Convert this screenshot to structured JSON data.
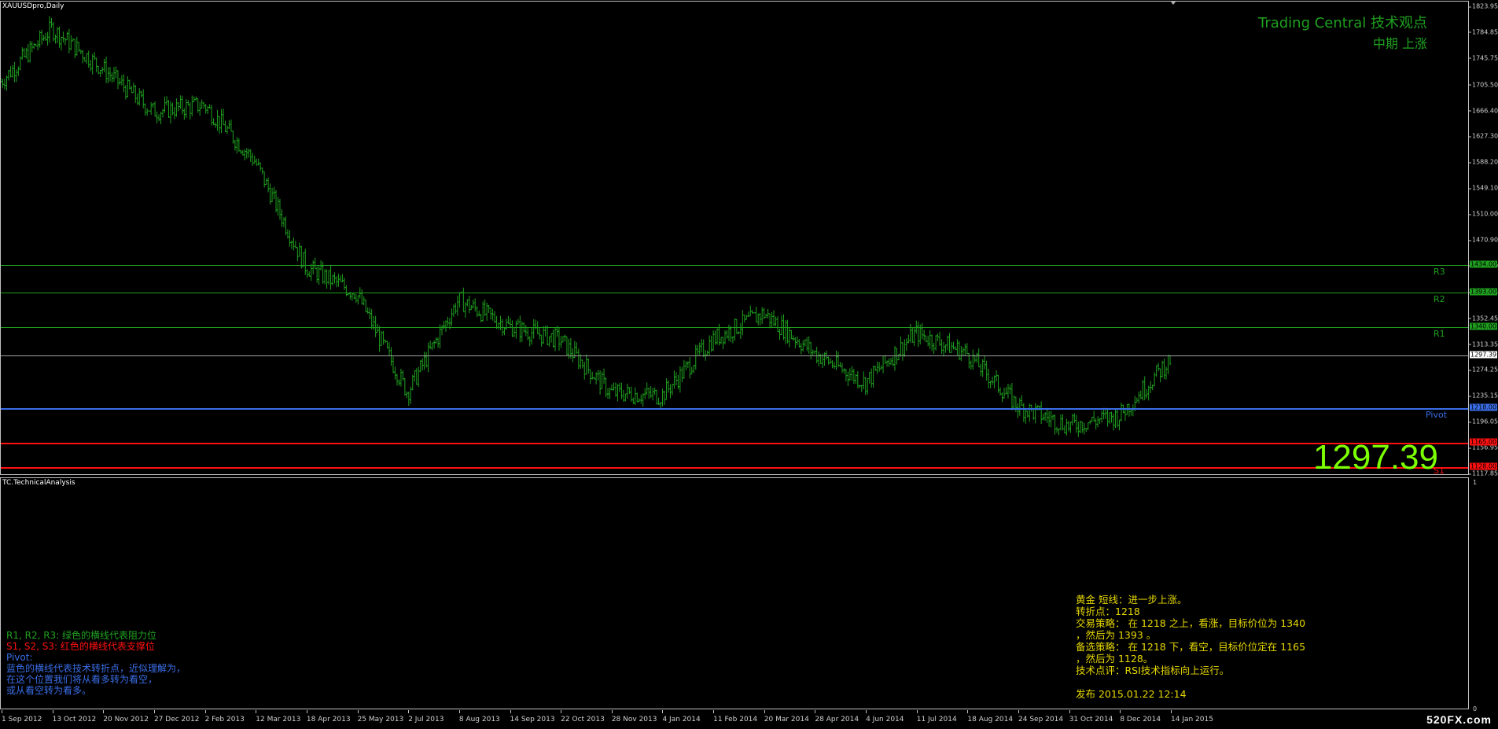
{
  "window": {
    "chart_title": "XAUUSDpro,Daily",
    "indicator_title": "TC.TechnicalAnalysis"
  },
  "header": {
    "title": "Trading Central 技术观点",
    "subtitle": "中期 上涨"
  },
  "current_price": "1297.39",
  "price_axis": [
    "1823.95",
    "1784.85",
    "1745.75",
    "1705.50",
    "1666.40",
    "1627.30",
    "1588.20",
    "1549.10",
    "1510.00",
    "1470.90",
    "1431.80",
    "1391.55",
    "1352.45",
    "1313.35",
    "1274.25",
    "1235.15",
    "1196.05",
    "1156.95",
    "1117.85"
  ],
  "levels": [
    {
      "name": "R3",
      "value": "1434.00",
      "price": 1434,
      "color": "#1fa01f",
      "tag_bg": "#1fa01f",
      "tag_fg": "#000"
    },
    {
      "name": "R2",
      "value": "1393.00",
      "price": 1393,
      "color": "#1fa01f",
      "tag_bg": "#1fa01f",
      "tag_fg": "#000"
    },
    {
      "name": "R1",
      "value": "1340.00",
      "price": 1340,
      "color": "#1fa01f",
      "tag_bg": "#1fa01f",
      "tag_fg": "#000"
    },
    {
      "name": "",
      "value": "1297.39",
      "price": 1297.39,
      "color": "#a0a0a0",
      "tag_bg": "#ffffff",
      "tag_fg": "#000"
    },
    {
      "name": "Pivot",
      "value": "1218.00",
      "price": 1218,
      "color": "#3a6ee8",
      "tag_bg": "#3a6ee8",
      "tag_fg": "#000"
    },
    {
      "name": "",
      "value": "1165.00",
      "price": 1165,
      "color": "#ff1010",
      "tag_bg": "#ff1010",
      "tag_fg": "#000"
    },
    {
      "name": "S1",
      "value": "1128.00",
      "price": 1128,
      "color": "#ff1010",
      "tag_bg": "#ff1010",
      "tag_fg": "#000"
    }
  ],
  "date_axis": [
    "1 Sep 2012",
    "13 Oct 2012",
    "20 Nov 2012",
    "27 Dec 2012",
    "2 Feb 2013",
    "12 Mar 2013",
    "18 Apr 2013",
    "25 May 2013",
    "2 Jul 2013",
    "8 Aug 2013",
    "14 Sep 2013",
    "22 Oct 2013",
    "28 Nov 2013",
    "4 Jan 2014",
    "11 Feb 2014",
    "20 Mar 2014",
    "28 Apr 2014",
    "4 Jun 2014",
    "11 Jul 2014",
    "18 Aug 2014",
    "24 Sep 2014",
    "31 Oct 2014",
    "8 Dec 2014",
    "14 Jan 2015"
  ],
  "indicator_scale": {
    "top": "1",
    "bottom": "0"
  },
  "legend": {
    "resistance": "R1, R2, R3: 绿色的横线代表阻力位",
    "support": "S1, S2, S3: 红色的横线代表支撑位",
    "pivot_title": "Pivot:",
    "pivot_lines": [
      "蓝色的横线代表技术转折点，近似理解为，",
      "在这个位置我们将从看多转为看空，",
      "或从看空转为看多。"
    ]
  },
  "analysis": {
    "lines": [
      "黄金 短线：进一步上涨。",
      "转折点：1218",
      "交易策略： 在 1218 之上，看涨，目标价位为 1340",
      "，然后为 1393 。",
      "备选策略： 在 1218 下，看空，目标价位定在 1165",
      "，然后为 1128。",
      "技术点评：RSI技术指标向上运行。",
      "",
      "发布 2015.01.22 12:14"
    ]
  },
  "watermark": "520FX.com",
  "colors": {
    "candles": "#1fa01f",
    "resistance": "#1fa01f",
    "support": "#ff1010",
    "pivot": "#3a6ee8",
    "big_price": "#7cff00",
    "analysis": "#e6d800"
  },
  "chart_data": {
    "type": "line",
    "xlabel": "",
    "ylabel": "",
    "ylim": [
      1117.85,
      1823.95
    ],
    "x": [
      "1 Sep 2012",
      "13 Oct 2012",
      "20 Nov 2012",
      "27 Dec 2012",
      "2 Feb 2013",
      "12 Mar 2013",
      "18 Apr 2013",
      "25 May 2013",
      "2 Jul 2013",
      "8 Aug 2013",
      "14 Sep 2013",
      "22 Oct 2013",
      "28 Nov 2013",
      "4 Jan 2014",
      "11 Feb 2014",
      "20 Mar 2014",
      "28 Apr 2014",
      "4 Jun 2014",
      "11 Jul 2014",
      "18 Aug 2014",
      "24 Sep 2014",
      "31 Oct 2014",
      "8 Dec 2014",
      "14 Jan 2015"
    ],
    "series": [
      {
        "values": [
          1710,
          1790,
          1730,
          1665,
          1675,
          1590,
          1430,
          1390,
          1240,
          1380,
          1340,
          1320,
          1240,
          1235,
          1320,
          1360,
          1300,
          1255,
          1330,
          1300,
          1220,
          1190,
          1205,
          1290
        ]
      }
    ]
  }
}
